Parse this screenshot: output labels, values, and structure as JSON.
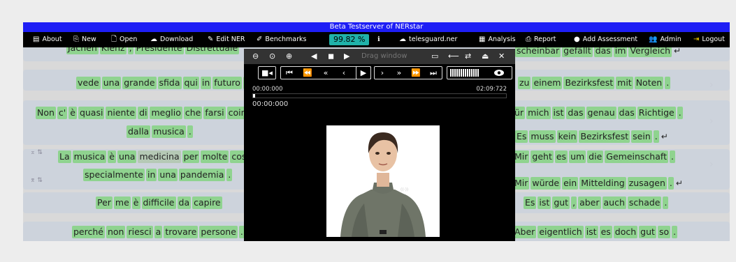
{
  "window": {
    "title": "Beta Testserver of NERstar"
  },
  "nav": {
    "about": "About",
    "new": "New",
    "open": "Open",
    "download": "Download",
    "edit_ner": "Edit NER",
    "benchmarks": "Benchmarks",
    "progress": "99.82 %",
    "info": "ℹ",
    "server": "telesguard.ner",
    "analysis": "Analysis",
    "report": "Report",
    "add_assessment": "Add Assessment",
    "admin": "Admin",
    "logout": "Logout"
  },
  "player": {
    "drag_label": "Drag window",
    "time_start": "00:00:000",
    "time_end": "02:09:722",
    "time_current": "00:00:000",
    "progress_fraction": 0.0
  },
  "rows": [
    {
      "left": [
        "Jachen",
        "Kienz",
        ",",
        "Presidente",
        "Distrettuale"
      ],
      "right": [
        "scheinbar",
        "gefällt",
        "das",
        "im",
        "Vergleich"
      ]
    },
    {
      "left": [
        "vede",
        "una",
        "grande",
        "sfida",
        "qui",
        "in",
        "futuro",
        ":"
      ],
      "right": [
        "zu",
        "einem",
        "Bezirksfest",
        "mit",
        "Noten",
        "."
      ]
    },
    {
      "left": [
        "Non",
        "c'",
        "è",
        "quasi",
        "niente",
        "di",
        "meglio",
        "che",
        "farsi",
        "coin"
      ],
      "right": [
        "ür",
        "mich",
        "ist",
        "das",
        "genau",
        "das",
        "Richtige",
        "."
      ]
    },
    {
      "left": [
        "dalla",
        "musica",
        "."
      ],
      "right": [
        "Es",
        "muss",
        "kein",
        "Bezirksfest",
        "sein",
        "."
      ]
    },
    {
      "left": [
        "La",
        "musica",
        "è",
        "una",
        "medicina",
        "per",
        "molte",
        "cos"
      ],
      "right": [
        "Mir",
        "geht",
        "es",
        "um",
        "die",
        "Gemeinschaft",
        "."
      ]
    },
    {
      "left": [
        "specialmente",
        "in",
        "una",
        "pandemia",
        "."
      ],
      "right": [
        "Mir",
        "würde",
        "ein",
        "Mittelding",
        "zusagen",
        "."
      ]
    },
    {
      "left": [
        "Per",
        "me",
        "è",
        "difficile",
        "da",
        "capire"
      ],
      "right": [
        "Es",
        "ist",
        "gut",
        ",",
        "aber",
        "auch",
        "schade",
        "."
      ]
    },
    {
      "left": [
        "perché",
        "non",
        "riesci",
        "a",
        "trovare",
        "persone",
        "."
      ],
      "right": [
        "Aber",
        "eigentlich",
        "ist",
        "es",
        "doch",
        "gut",
        "so",
        "."
      ]
    }
  ],
  "icons": {
    "para_return": "↵"
  }
}
